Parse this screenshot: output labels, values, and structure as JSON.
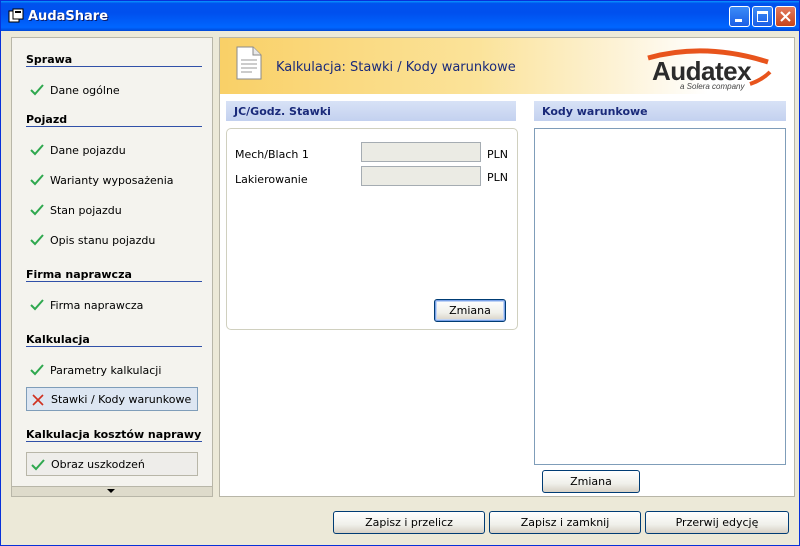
{
  "window": {
    "title": "AudaShare"
  },
  "sidebar": {
    "sections": [
      {
        "heading": "Sprawa",
        "items": [
          {
            "label": "Dane ogólne",
            "status": "done"
          }
        ]
      },
      {
        "heading": "Pojazd",
        "items": [
          {
            "label": "Dane pojazdu",
            "status": "done"
          },
          {
            "label": "Warianty wyposażenia",
            "status": "done"
          },
          {
            "label": "Stan pojazdu",
            "status": "done"
          },
          {
            "label": "Opis stanu pojazdu",
            "status": "done"
          }
        ]
      },
      {
        "heading": "Firma naprawcza",
        "items": [
          {
            "label": "Firma naprawcza",
            "status": "done"
          }
        ]
      },
      {
        "heading": "Kalkulacja",
        "items": [
          {
            "label": "Parametry kalkulacji",
            "status": "done"
          },
          {
            "label": "Stawki / Kody warunkowe",
            "status": "error"
          }
        ]
      },
      {
        "heading": "Kalkulacja kosztów naprawy",
        "items": [
          {
            "label": "Obraz uszkodzeń",
            "status": "done"
          }
        ]
      }
    ]
  },
  "banner": {
    "title": "Kalkulacja: Stawki / Kody warunkowe",
    "logo_text": "Audatex",
    "logo_subtext": "a Solera company"
  },
  "rates_panel": {
    "heading": "JC/Godz. Stawki",
    "fields": [
      {
        "label": "Mech/Blach 1",
        "value": "",
        "unit": "PLN"
      },
      {
        "label": "Lakierowanie",
        "value": "",
        "unit": "PLN"
      }
    ],
    "change_button": "Zmiana"
  },
  "codes_panel": {
    "heading": "Kody warunkowe",
    "items": [],
    "change_button": "Zmiana"
  },
  "footer": {
    "save_recalc": "Zapisz i przelicz",
    "save_close": "Zapisz i zamknij",
    "abort_edit": "Przerwij edycję"
  },
  "colors": {
    "title_bar": "#0054e3",
    "check_green": "#2fa84f",
    "error_red": "#d03020",
    "section_line": "#3050a8",
    "banner_gradient_start": "#f9d067",
    "logo_accent": "#e8541c"
  }
}
